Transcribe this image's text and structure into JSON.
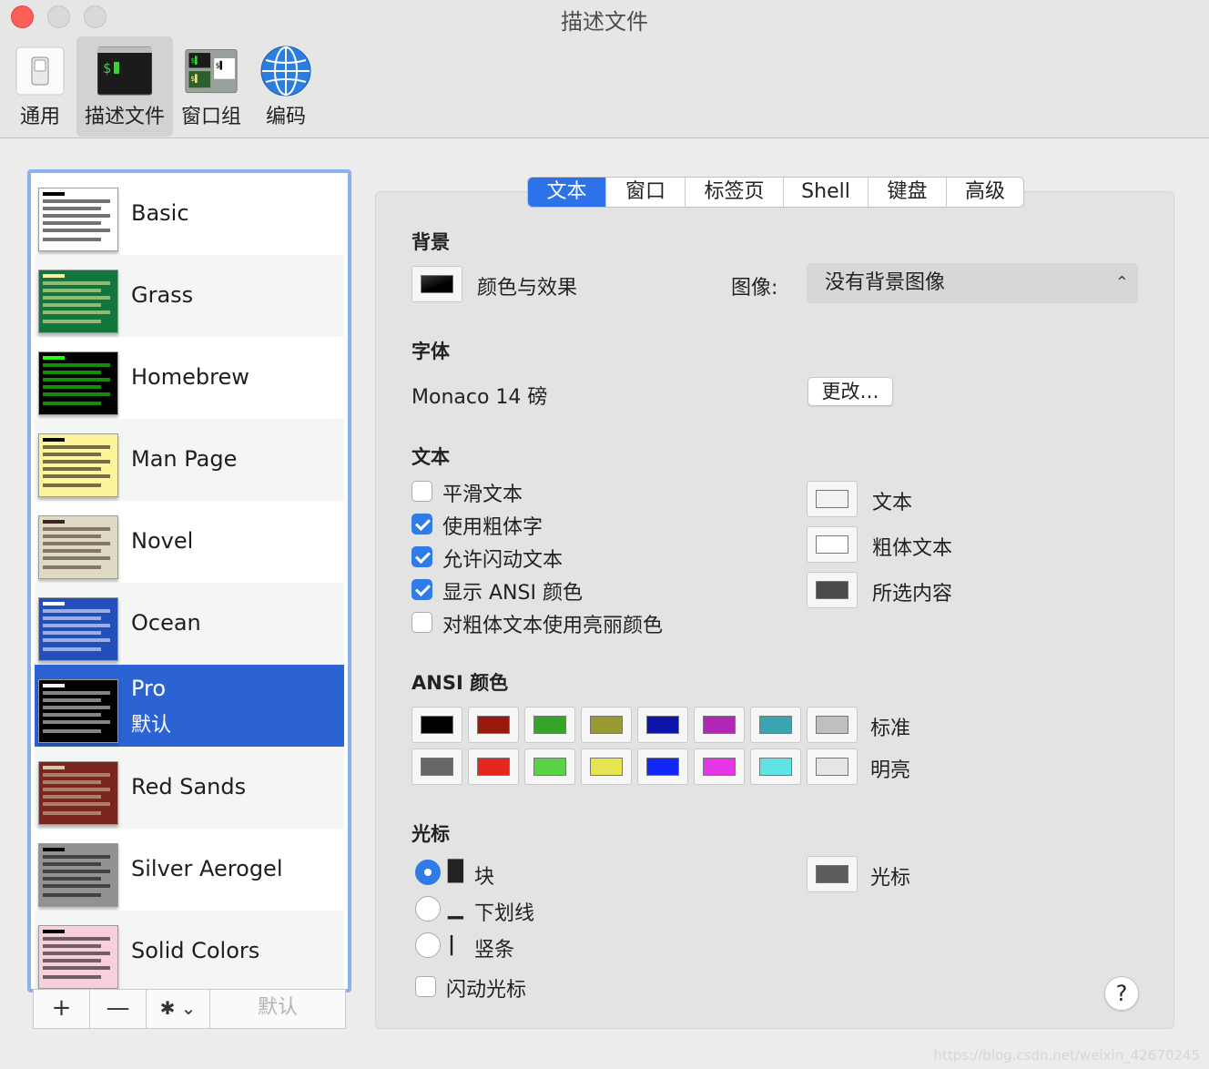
{
  "window": {
    "title": "描述文件"
  },
  "toolbar": {
    "items": [
      {
        "label": "通用",
        "icon": "switch-icon"
      },
      {
        "label": "描述文件",
        "icon": "terminal-icon",
        "active": true
      },
      {
        "label": "窗口组",
        "icon": "window-group-icon"
      },
      {
        "label": "编码",
        "icon": "globe-icon"
      }
    ]
  },
  "profiles": [
    {
      "name": "Basic",
      "bg": "#ffffff",
      "fg": "#000000"
    },
    {
      "name": "Grass",
      "bg": "#13773d",
      "fg": "#fff0a5"
    },
    {
      "name": "Homebrew",
      "bg": "#000000",
      "fg": "#28fe14"
    },
    {
      "name": "Man Page",
      "bg": "#fef49c",
      "fg": "#000000"
    },
    {
      "name": "Novel",
      "bg": "#dfdbc3",
      "fg": "#3b2322"
    },
    {
      "name": "Ocean",
      "bg": "#224fbc",
      "fg": "#ffffff"
    },
    {
      "name": "Pro",
      "sub": "默认",
      "bg": "#000000",
      "fg": "#f2f2f2",
      "selected": true
    },
    {
      "name": "Red Sands",
      "bg": "#7a251e",
      "fg": "#d7c9a7"
    },
    {
      "name": "Silver Aerogel",
      "bg": "#929292",
      "fg": "#000000"
    },
    {
      "name": "Solid Colors",
      "bg": "#f7d0dc",
      "fg": "#000000"
    }
  ],
  "list_buttons": {
    "add": "+",
    "remove": "—",
    "gear": "✱ ⌄",
    "default": "默认"
  },
  "tabs": [
    "文本",
    "窗口",
    "标签页",
    "Shell",
    "键盘",
    "高级"
  ],
  "background": {
    "title": "背景",
    "color_label": "颜色与效果",
    "image_label": "图像:",
    "image_value": "没有背景图像",
    "swatch": "#111111"
  },
  "font": {
    "title": "字体",
    "value": "Monaco 14 磅",
    "change_button": "更改…"
  },
  "text": {
    "title": "文本",
    "options": [
      {
        "label": "平滑文本",
        "checked": false
      },
      {
        "label": "使用粗体字",
        "checked": true
      },
      {
        "label": "允许闪动文本",
        "checked": true
      },
      {
        "label": "显示 ANSI 颜色",
        "checked": true
      },
      {
        "label": "对粗体文本使用亮丽颜色",
        "checked": false
      }
    ],
    "colors": [
      {
        "label": "文本",
        "color": "#f2f2f2"
      },
      {
        "label": "粗体文本",
        "color": "#ffffff"
      },
      {
        "label": "所选内容",
        "color": "#4a4a4a"
      }
    ]
  },
  "ansi": {
    "title": "ANSI 颜色",
    "normal_label": "标准",
    "bright_label": "明亮",
    "normal": [
      "#000000",
      "#991a0d",
      "#35a52a",
      "#999933",
      "#0b14a6",
      "#b128b8",
      "#3aa4b3",
      "#bfbfbf"
    ],
    "bright": [
      "#666666",
      "#e5281d",
      "#5ad246",
      "#e5e54f",
      "#1127f5",
      "#e535e5",
      "#5fe3e5",
      "#e5e5e5"
    ]
  },
  "cursor": {
    "title": "光标",
    "options": [
      {
        "glyph": "█",
        "label": "块",
        "selected": true
      },
      {
        "glyph": "▁",
        "label": "下划线",
        "selected": false
      },
      {
        "glyph": "|",
        "label": "竖条",
        "selected": false
      }
    ],
    "blink_label": "闪动光标",
    "color_label": "光标",
    "color": "#5c5c5c"
  },
  "help": "?",
  "watermark": "https://blog.csdn.net/weixin_42670245"
}
